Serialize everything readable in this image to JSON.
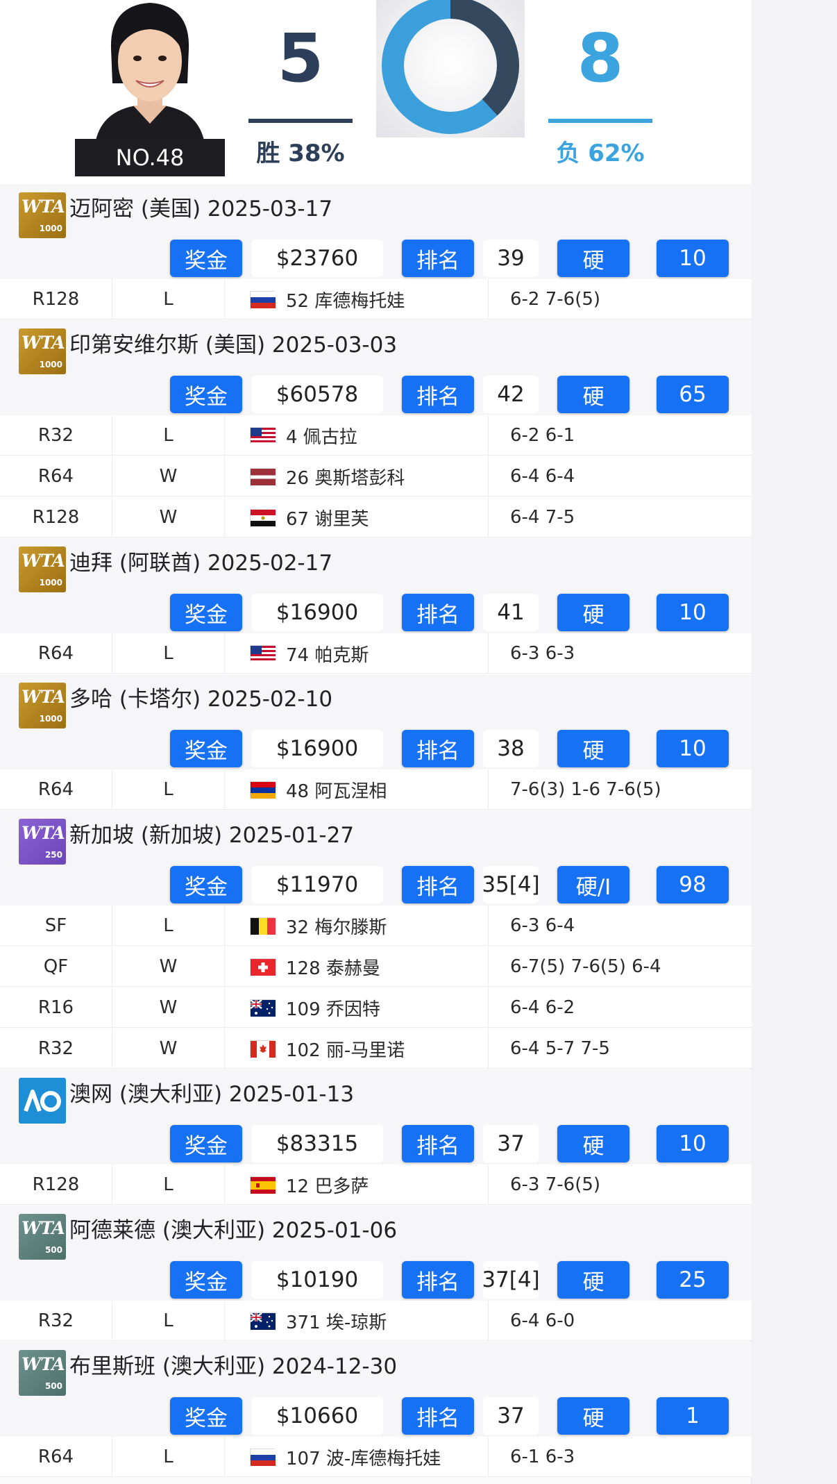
{
  "player": {
    "rank_label": "NO.48",
    "wins": "5",
    "losses": "8",
    "win_label": "胜 38%",
    "loss_label": "负 62%",
    "win_ratio": 0.38,
    "colors": {
      "win": "#2c3e5a",
      "loss": "#3ba4df"
    }
  },
  "labels": {
    "prize": "奖金",
    "rank": "排名"
  },
  "tournaments": [
    {
      "logo": "WTA 1000",
      "title": "迈阿密 (美国) 2025-03-17",
      "prize": "$23760",
      "rank": "39",
      "surface": "硬",
      "points": "10",
      "matches": [
        {
          "round": "R128",
          "result": "L",
          "flag": "russia-flag",
          "opponent": "52 库德梅托娃",
          "score": "6-2 7-6(5)"
        }
      ]
    },
    {
      "logo": "WTA 1000",
      "title": "印第安维尔斯 (美国) 2025-03-03",
      "prize": "$60578",
      "rank": "42",
      "surface": "硬",
      "points": "65",
      "matches": [
        {
          "round": "R32",
          "result": "L",
          "flag": "usa-flag",
          "opponent": "4 佩古拉",
          "score": "6-2 6-1"
        },
        {
          "round": "R64",
          "result": "W",
          "flag": "latvia-flag",
          "opponent": "26 奥斯塔彭科",
          "score": "6-4 6-4"
        },
        {
          "round": "R128",
          "result": "W",
          "flag": "egypt-flag",
          "opponent": "67 谢里芙",
          "score": "6-4 7-5"
        }
      ]
    },
    {
      "logo": "WTA 1000",
      "title": "迪拜 (阿联酋) 2025-02-17",
      "prize": "$16900",
      "rank": "41",
      "surface": "硬",
      "points": "10",
      "matches": [
        {
          "round": "R64",
          "result": "L",
          "flag": "usa-flag",
          "opponent": "74 帕克斯",
          "score": "6-3 6-3"
        }
      ]
    },
    {
      "logo": "WTA 1000",
      "title": "多哈 (卡塔尔) 2025-02-10",
      "prize": "$16900",
      "rank": "38",
      "surface": "硬",
      "points": "10",
      "matches": [
        {
          "round": "R64",
          "result": "L",
          "flag": "armenia-flag",
          "opponent": "48 阿瓦涅相",
          "score": "7-6(3) 1-6 7-6(5)"
        }
      ]
    },
    {
      "logo": "WTA 250",
      "title": "新加坡 (新加坡) 2025-01-27",
      "prize": "$11970",
      "rank": "35[4]",
      "surface": "硬/I",
      "points": "98",
      "matches": [
        {
          "round": "SF",
          "result": "L",
          "flag": "belgium-flag",
          "opponent": "32 梅尔滕斯",
          "score": "6-3 6-4"
        },
        {
          "round": "QF",
          "result": "W",
          "flag": "switzerland-flag",
          "opponent": "128 泰赫曼",
          "score": "6-7(5) 7-6(5) 6-4"
        },
        {
          "round": "R16",
          "result": "W",
          "flag": "australia-flag",
          "opponent": "109 乔因特",
          "score": "6-4 6-2"
        },
        {
          "round": "R32",
          "result": "W",
          "flag": "canada-flag",
          "opponent": "102 丽-马里诺",
          "score": "6-4 5-7 7-5"
        }
      ]
    },
    {
      "logo": "AO",
      "title": "澳网 (澳大利亚) 2025-01-13",
      "prize": "$83315",
      "rank": "37",
      "surface": "硬",
      "points": "10",
      "matches": [
        {
          "round": "R128",
          "result": "L",
          "flag": "spain-flag",
          "opponent": "12 巴多萨",
          "score": "6-3 7-6(5)"
        }
      ]
    },
    {
      "logo": "WTA 500",
      "title": "阿德莱德 (澳大利亚) 2025-01-06",
      "prize": "$10190",
      "rank": "37[4]",
      "surface": "硬",
      "points": "25",
      "matches": [
        {
          "round": "R32",
          "result": "L",
          "flag": "australia-flag",
          "opponent": "371 埃-琼斯",
          "score": "6-4 6-0"
        }
      ]
    },
    {
      "logo": "WTA 500",
      "title": "布里斯班 (澳大利亚) 2024-12-30",
      "prize": "$10660",
      "rank": "37",
      "surface": "硬",
      "points": "1",
      "matches": [
        {
          "round": "R64",
          "result": "L",
          "flag": "russia-flag",
          "opponent": "107 波-库德梅托娃",
          "score": "6-1 6-3"
        }
      ]
    }
  ]
}
